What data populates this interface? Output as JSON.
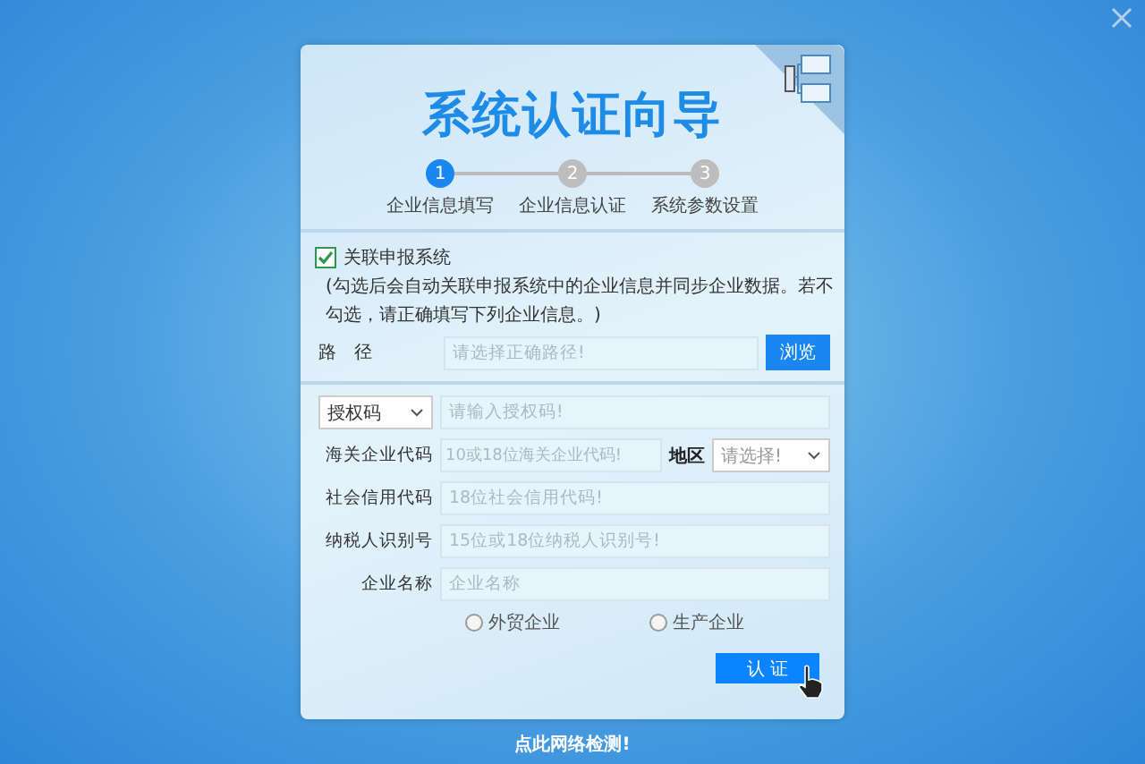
{
  "title": "系统认证向导",
  "steps": [
    {
      "number": "1",
      "label": "企业信息填写",
      "selected": true
    },
    {
      "number": "2",
      "label": "企业信息认证",
      "selected": false
    },
    {
      "number": "3",
      "label": "系统参数设置",
      "selected": false
    }
  ],
  "link_system": {
    "label": "关联申报系统",
    "checked": true,
    "note": "(勾选后会自动关联申报系统中的企业信息并同步企业数据。若不勾选，请正确填写下列企业信息。)"
  },
  "path": {
    "label": "路　径",
    "placeholder": "请选择正确路径!",
    "button": "浏览"
  },
  "auth": {
    "select": "授权码",
    "placeholder": "请输入授权码!"
  },
  "fields": [
    {
      "label": "海关企业代码",
      "placeholder": "10或18位海关企业代码!"
    },
    {
      "label": "社会信用代码",
      "placeholder": "18位社会信用代码!"
    },
    {
      "label": "纳税人识别号",
      "placeholder": "15位或18位纳税人识别号!"
    },
    {
      "label": "企业名称",
      "placeholder": "企业名称"
    }
  ],
  "region": {
    "label": "地区",
    "select": "请选择!"
  },
  "company_types": [
    {
      "label": "外贸企业",
      "selected": false
    },
    {
      "label": "生产企业",
      "selected": false
    }
  ],
  "submit_button": "认 证",
  "footer_link": "点此网络检测!"
}
